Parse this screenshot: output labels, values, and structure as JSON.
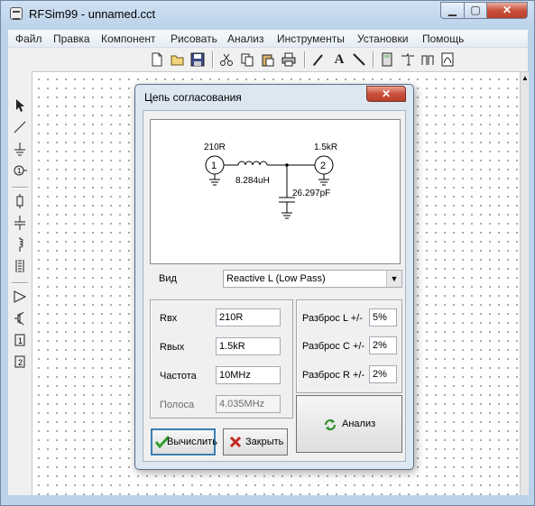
{
  "window": {
    "title": "RFSim99 - unnamed.cct",
    "min_glyph": "▁",
    "max_glyph": "▢",
    "close_glyph": "✕"
  },
  "menu": [
    "Файл",
    "Правка",
    "Компонент",
    "Рисовать",
    "Анализ",
    "Инструменты",
    "Установки",
    "Помощь"
  ],
  "dialog": {
    "title": "Цепь согласования",
    "close_glyph": "✕",
    "schematic": {
      "port1_name": "210R",
      "port1_num": "1",
      "port2_name": "1.5kR",
      "port2_num": "2",
      "inductor": "8.284uH",
      "capacitor": "26.297pF"
    },
    "vid_label": "Вид",
    "vid_value": "Reactive L  (Low Pass)",
    "rin_label": "Rвх",
    "rin_value": "210R",
    "rout_label": "Rвых",
    "rout_value": "1.5kR",
    "freq_label": "Частота",
    "freq_value": "10MHz",
    "band_label": "Полоса",
    "band_value": "4.035MHz",
    "tol_l_label": "Разброс L +/-",
    "tol_l_value": "5%",
    "tol_c_label": "Разброс C +/-",
    "tol_c_value": "2%",
    "tol_r_label": "Разброс R +/-",
    "tol_r_value": "2%",
    "calc_label": "Вычислить",
    "close_label": "Закрыть",
    "analysis_label": "Анализ"
  }
}
